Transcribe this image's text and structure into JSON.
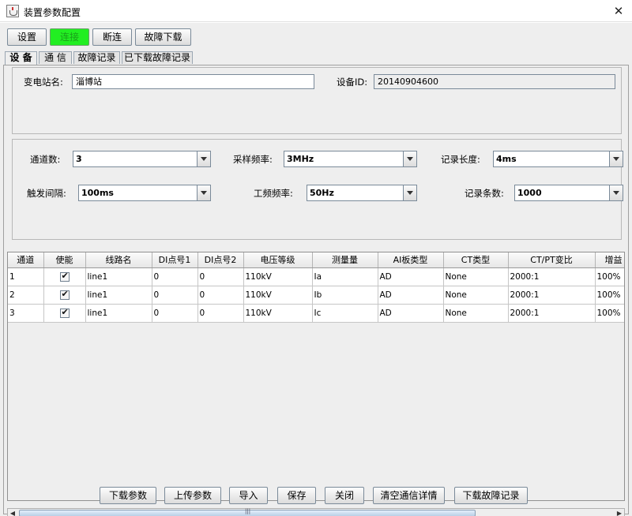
{
  "window": {
    "title": "装置参数配置",
    "close_glyph": "✕"
  },
  "toolbar": {
    "buttons": [
      {
        "label": "设置"
      },
      {
        "label": "连接"
      },
      {
        "label": "断连"
      },
      {
        "label": "故障下载"
      }
    ],
    "connected_color": "#22ee22"
  },
  "tabs": [
    {
      "label": "设 备"
    },
    {
      "label": "通 信"
    },
    {
      "label": "故障记录"
    },
    {
      "label": "已下载故障记录"
    }
  ],
  "device": {
    "station_label": "变电站名:",
    "station_value": "淄博站",
    "device_id_label": "设备ID:",
    "device_id_value": "20140904600"
  },
  "params": {
    "channels_label": "通道数:",
    "channels_value": "3",
    "sample_rate_label": "采样频率:",
    "sample_rate_value": "3MHz",
    "record_length_label": "记录长度:",
    "record_length_value": "4ms",
    "trigger_interval_label": "触发间隔:",
    "trigger_interval_value": "100ms",
    "power_freq_label": "工频频率:",
    "power_freq_value": "50Hz",
    "record_count_label": "记录条数:",
    "record_count_value": "1000"
  },
  "table": {
    "columns": [
      "通道",
      "使能",
      "线路名",
      "DI点号1",
      "DI点号2",
      "电压等级",
      "测量量",
      "AI板类型",
      "CT类型",
      "CT/PT变比",
      "增益"
    ],
    "rows": [
      {
        "channel": "1",
        "enabled": true,
        "line": "line1",
        "di1": "0",
        "di2": "0",
        "voltage": "110kV",
        "measure": "Ia",
        "ai_type": "AD",
        "ct_type": "None",
        "ratio": "2000:1",
        "gain": "100%"
      },
      {
        "channel": "2",
        "enabled": true,
        "line": "line1",
        "di1": "0",
        "di2": "0",
        "voltage": "110kV",
        "measure": "Ib",
        "ai_type": "AD",
        "ct_type": "None",
        "ratio": "2000:1",
        "gain": "100%"
      },
      {
        "channel": "3",
        "enabled": true,
        "line": "line1",
        "di1": "0",
        "di2": "0",
        "voltage": "110kV",
        "measure": "Ic",
        "ai_type": "AD",
        "ct_type": "None",
        "ratio": "2000:1",
        "gain": "100%"
      }
    ]
  },
  "scrollbar": {
    "left_glyph": "◀",
    "right_glyph": "▶",
    "grip": "|||"
  },
  "actions": [
    {
      "label": "下载参数"
    },
    {
      "label": "上传参数"
    },
    {
      "label": "导入"
    },
    {
      "label": "保存"
    },
    {
      "label": "关闭"
    },
    {
      "label": "清空通信详情"
    },
    {
      "label": "下载故障记录"
    }
  ]
}
